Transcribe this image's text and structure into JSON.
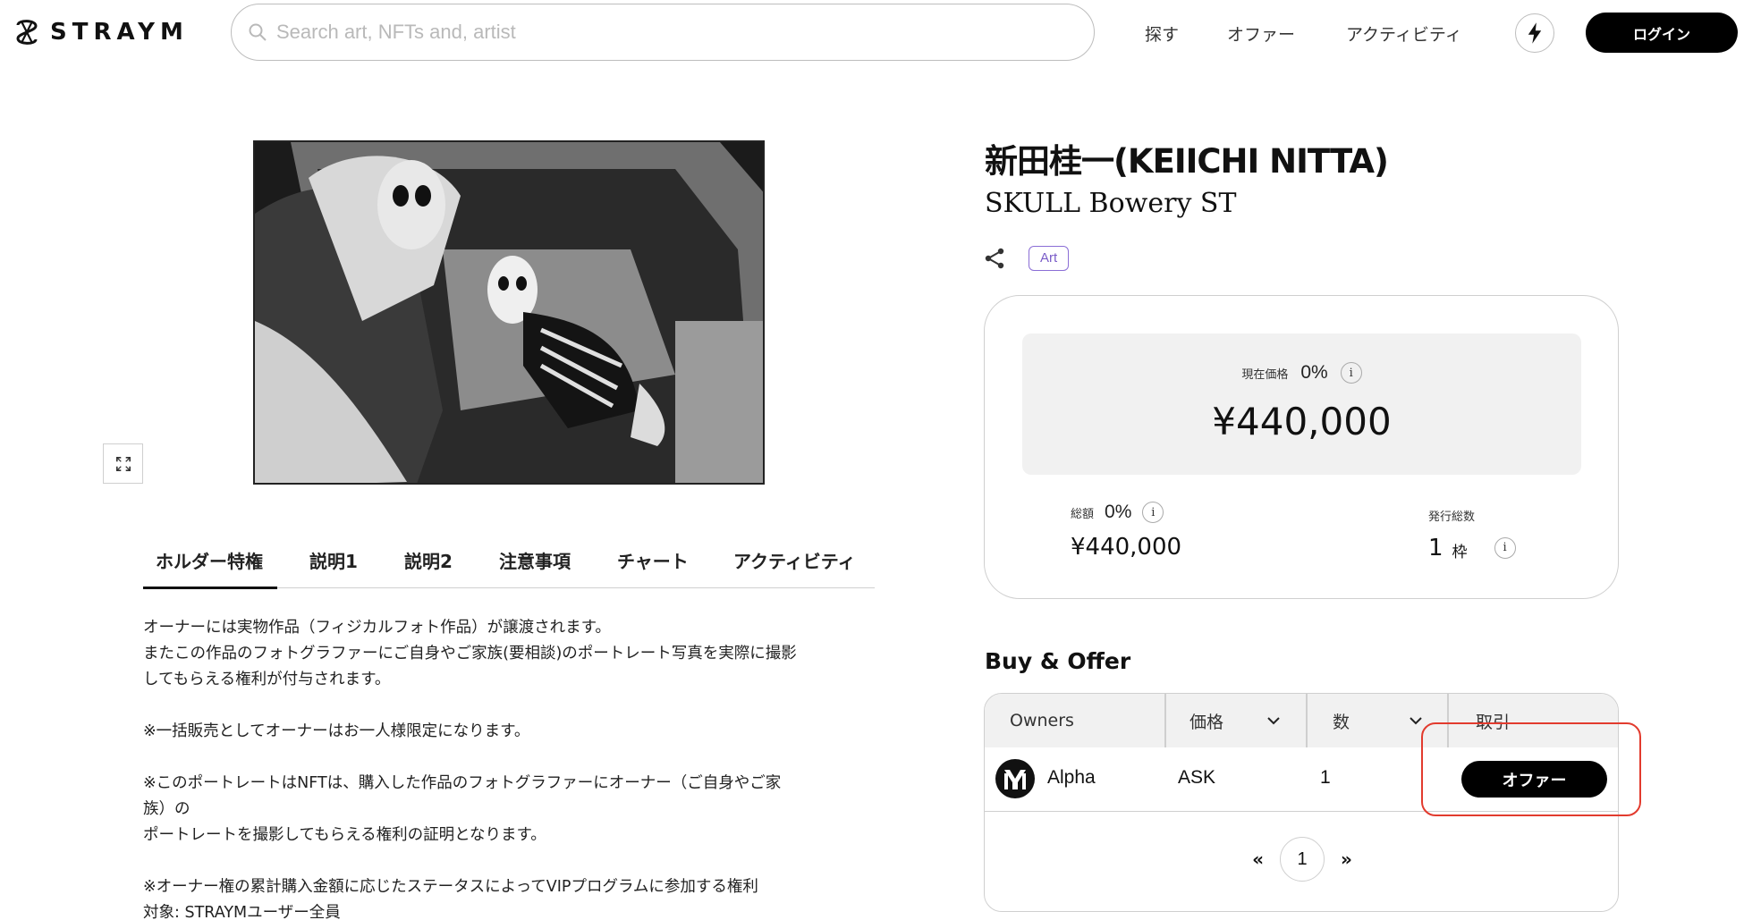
{
  "header": {
    "brand": "STRAYM",
    "search_placeholder": "Search art, NFTs and, artist",
    "nav": [
      "探す",
      "オファー",
      "アクティビティ"
    ],
    "login_label": "ログイン"
  },
  "artwork": {
    "artist": "新田桂一(KEIICHI NITTA)",
    "title": "SKULL Bowery ST",
    "category_badge": "Art"
  },
  "tabs": [
    "ホルダー特権",
    "説明1",
    "説明2",
    "注意事項",
    "チャート",
    "アクティビティ"
  ],
  "description": [
    "オーナーには実物作品（フィジカルフォト作品）が譲渡されます。",
    "またこの作品のフォトグラファーにご自身やご家族(要相談)のポートレート写真を実際に撮影",
    "してもらえる権利が付与されます。",
    "",
    "※一括販売としてオーナーはお一人様限定になります。",
    "",
    "※このポートレートはNFTは、購入した作品のフォトグラファーにオーナー（ご自身やご家",
    "族）の",
    "ポートレートを撮影してもらえる権利の証明となります。",
    "",
    "※オーナー権の累計購入金額に応じたステータスによってVIPプログラムに参加する権利",
    "対象: STRAYMユーザー全員"
  ],
  "price": {
    "current_label": "現在価格",
    "current_change": "0%",
    "current_price": "¥440,000",
    "total_label": "総額",
    "total_change": "0%",
    "total_price": "¥440,000",
    "issued_label": "発行総数",
    "issued_count": "1",
    "issued_unit": "枠",
    "info_glyph": "i"
  },
  "buy_offer": {
    "title": "Buy & Offer",
    "columns": [
      "Owners",
      "価格",
      "数",
      "取引"
    ],
    "rows": [
      {
        "owner": "Alpha",
        "price": "ASK",
        "qty": "1",
        "action": "オファー"
      }
    ],
    "pagination": {
      "prev": "«",
      "current": "1",
      "next": "»"
    }
  },
  "colors": {
    "accent": "#000000",
    "badge": "#7a5cc8",
    "highlight": "#e23b2e",
    "panel": "#f1f1f1"
  }
}
